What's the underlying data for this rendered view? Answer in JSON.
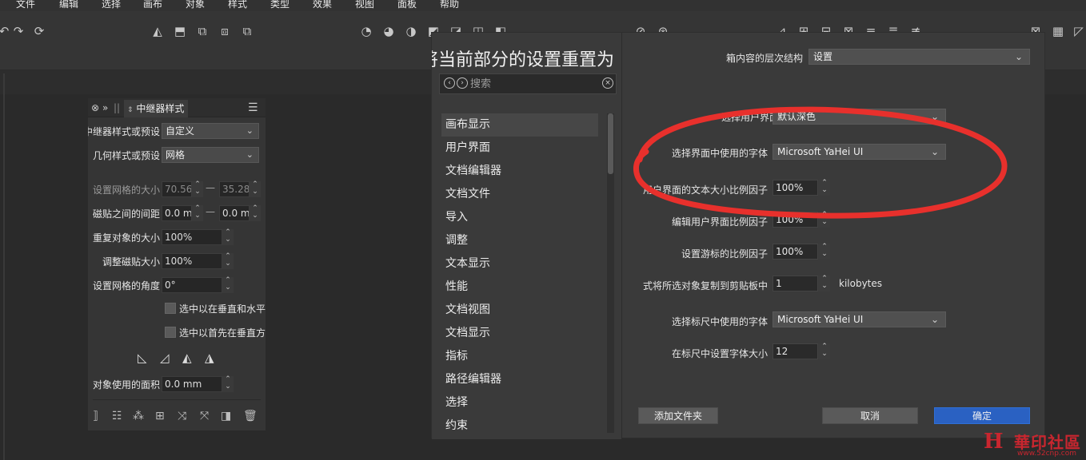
{
  "menubar": {
    "items": [
      "文件",
      "编辑",
      "选择",
      "画布",
      "对象",
      "样式",
      "类型",
      "效果",
      "视图",
      "面板",
      "帮助"
    ]
  },
  "toolbar": {
    "icons": [
      "undo-icon",
      "redo-icon",
      "rotate-icon",
      "flip-horizontal-icon",
      "flip-vertical-icon",
      "transform-icon",
      "transform-icon",
      "transform-icon",
      "shape-icon",
      "shape-icon",
      "shape-icon",
      "shape-icon",
      "shape-icon",
      "shape-icon",
      "shape-icon",
      "tool-icon",
      "tool-icon",
      "tool-icon",
      "tool-icon",
      "tool-icon",
      "tool-icon",
      "tool-icon",
      "tool-icon",
      "tool-icon"
    ]
  },
  "panel": {
    "tab_label": "中继器样式",
    "rows": {
      "style_preset_label": "中继器样式或预设",
      "style_preset_value": "自定义",
      "geometry_preset_label": "几何样式或预设",
      "geometry_preset_value": "网格",
      "grid_size_label": "设置网格的大小",
      "grid_size_w": "70.56",
      "grid_size_h": "35.28",
      "tile_gap_label": "磁贴之间的间距",
      "tile_gap_a": "0.0 mm",
      "tile_gap_b": "0.0 mm",
      "copy_size_label": "重复对象的大小",
      "copy_size_value": "100%",
      "tile_scale_label": "调整磁贴大小",
      "tile_scale_value": "100%",
      "grid_angle_label": "设置网格的角度",
      "grid_angle_value": "0°",
      "check1_label": "选中以在垂直和水平",
      "check2_label": "选中以首先在垂直方",
      "area_label": "对象使用的面积",
      "area_value": "0.0 mm"
    }
  },
  "dialog": {
    "title": "将当前部分的设置重置为",
    "search_placeholder": "搜索",
    "nav_items": [
      "画布显示",
      "用户界面",
      "文档编辑器",
      "文档文件",
      "导入",
      "调整",
      "文本显示",
      "性能",
      "文档视图",
      "文档显示",
      "指标",
      "路径编辑器",
      "选择",
      "约束"
    ],
    "settings": {
      "hierarchy_label": "箱内容的层次结构",
      "hierarchy_value": "设置",
      "theme_label": "选择用户界面主题",
      "theme_value": "默认深色",
      "ui_font_label": "选择界面中使用的字体",
      "ui_font_value": "Microsoft YaHei UI",
      "text_scale_label": "用户界面的文本大小比例因子",
      "text_scale_value": "100%",
      "ui_scale_label": "编辑用户界面比例因子",
      "ui_scale_value": "100%",
      "cursor_scale_label": "设置游标的比例因子",
      "cursor_scale_value": "100%",
      "clipboard_label": "式将所选对象复制到剪贴板中",
      "clipboard_value": "1",
      "clipboard_unit": "kilobytes",
      "ruler_font_label": "选择标尺中使用的字体",
      "ruler_font_value": "Microsoft YaHei UI",
      "ruler_size_label": "在标尺中设置字体大小",
      "ruler_size_value": "12"
    },
    "buttons": {
      "add_folder": "添加文件夹",
      "cancel": "取消",
      "ok": "确定"
    }
  },
  "annotation": {
    "color": "#e8302c"
  },
  "watermark": {
    "logo": "H",
    "text": "華印社區",
    "url": "www.52cnp.com"
  }
}
